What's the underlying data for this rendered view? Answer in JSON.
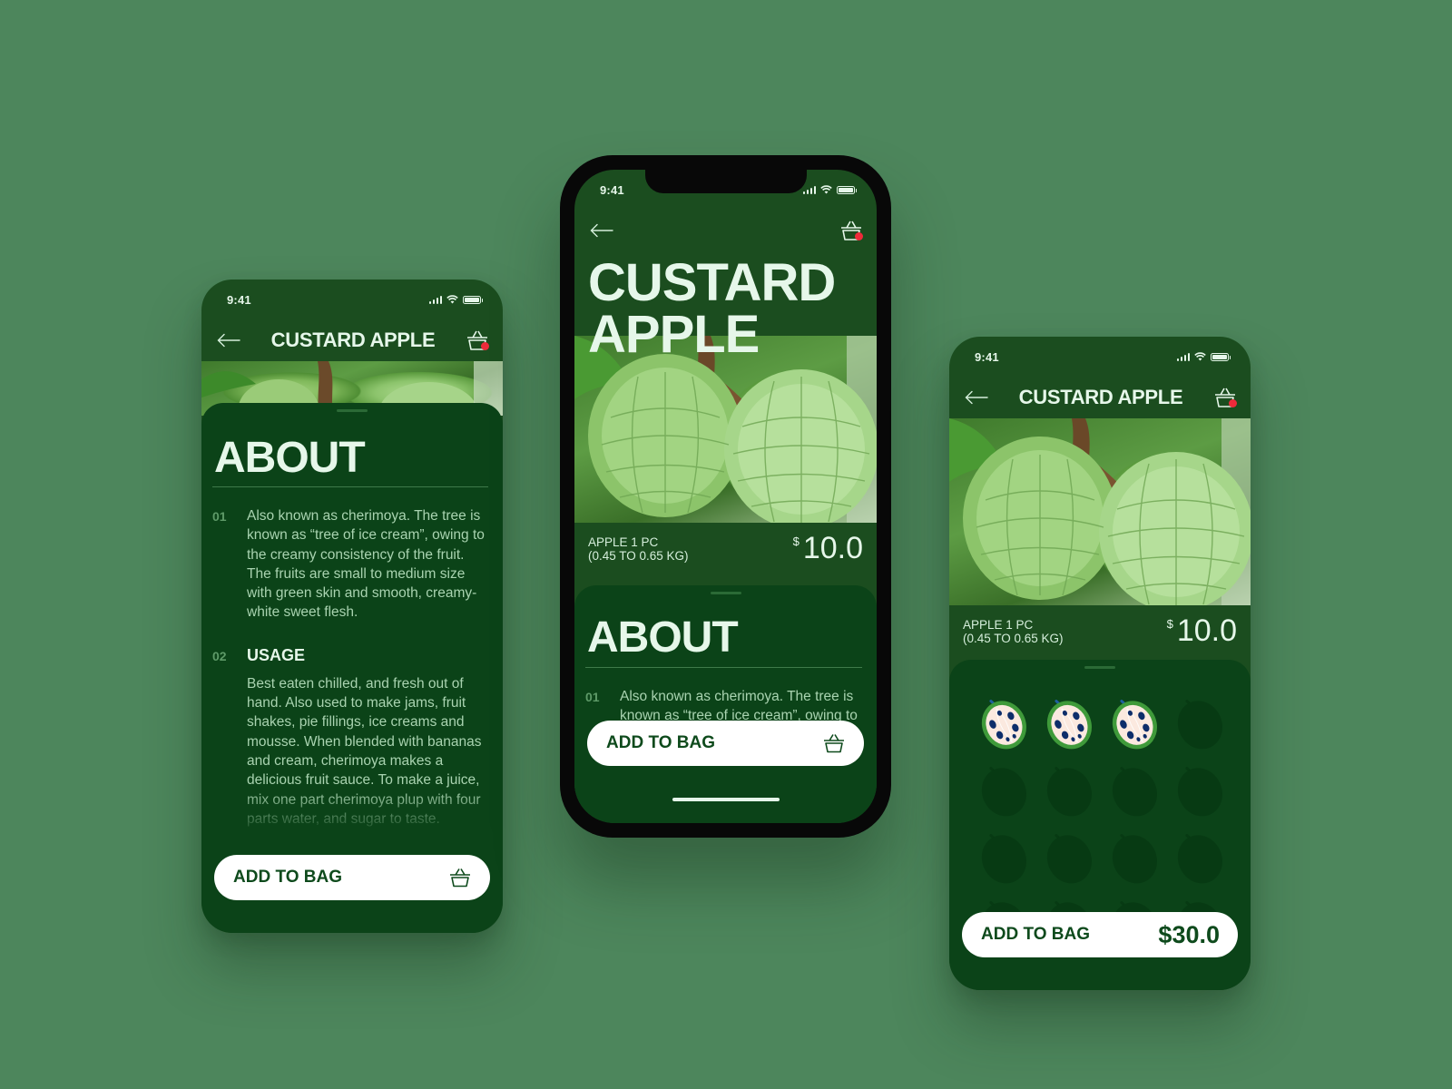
{
  "colors": {
    "background": "#4d865c",
    "app_bg": "#1b4d1f",
    "sheet_bg": "#0b4318",
    "text_light": "#e6f7ea",
    "accent_red": "#ee2a3a",
    "button_bg": "#ffffff",
    "button_text": "#0e4a1c"
  },
  "status_bar": {
    "time": "9:41"
  },
  "product": {
    "name": "CUSTARD APPLE",
    "name_line1": "CUSTARD",
    "name_line2": "APPLE",
    "unit_line1": "APPLE 1 PC",
    "unit_line2": "(0.45 TO 0.65 KG)",
    "currency": "$",
    "price": "10.0"
  },
  "about": {
    "title": "ABOUT",
    "items": [
      {
        "num": "01",
        "heading": "",
        "text": "Also known as cherimoya. The tree is known as “tree of ice cream”, owing to the creamy consistency of the fruit. The fruits are small to medium size with green skin and smooth, creamy-white sweet flesh."
      },
      {
        "num": "02",
        "heading": "USAGE",
        "text": "Best eaten chilled, and fresh out of hand. Also used to make jams, fruit shakes, pie fillings, ice creams and mousse. When blended with bananas and cream, cherimoya makes a delicious fruit sauce. To make a juice, mix one part cherimoya plup with four parts water, and sugar to taste."
      }
    ]
  },
  "icons": {
    "back": "arrow-left-icon",
    "cart": "basket-icon",
    "cart_badge": "notification-dot"
  },
  "add_to_bag": {
    "label": "ADD TO BAG",
    "total": "$30.0"
  },
  "quantity": {
    "selected": 3,
    "max": 16
  }
}
